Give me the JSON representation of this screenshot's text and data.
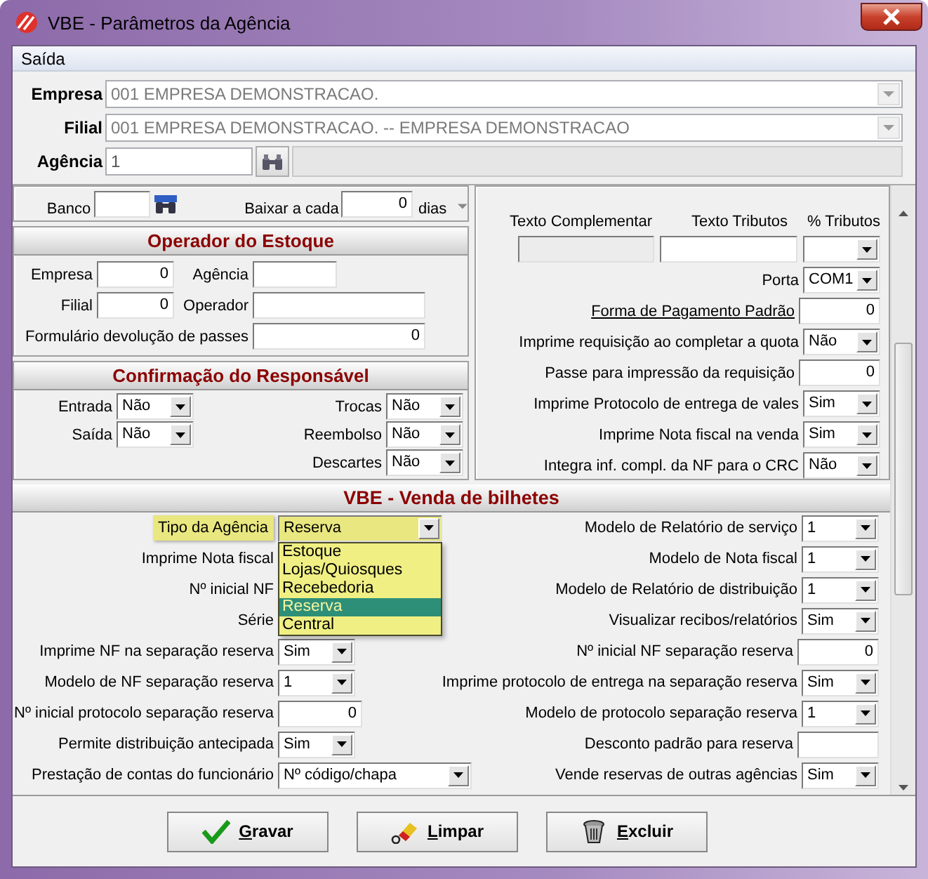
{
  "window": {
    "title": "VBE - Parâmetros da Agência"
  },
  "menu": [
    {
      "label": "Saída"
    }
  ],
  "header": [
    {
      "label": "Empresa",
      "value": "001 EMPRESA DEMONSTRACAO.",
      "kind": "select",
      "disabled": true
    },
    {
      "label": "Filial",
      "value": "001 EMPRESA DEMONSTRACAO. -- EMPRESA DEMONSTRACAO",
      "kind": "select",
      "disabled": true
    },
    {
      "label": "Agência",
      "value": "1",
      "kind": "lookup",
      "disabled": true
    }
  ],
  "banco": {
    "label": "Banco"
  },
  "baixar": {
    "label": "Baixar a cada",
    "value": "0",
    "unit": "dias"
  },
  "operador_estoque": {
    "title": "Operador do Estoque",
    "rows": [
      [
        {
          "label": "Empresa",
          "value": "0"
        },
        {
          "label": "Agência"
        }
      ],
      [
        {
          "label": "Filial",
          "value": "0"
        },
        {
          "label": "Operador"
        }
      ],
      [
        {
          "label": "Formulário devolução de passes",
          "value": "0"
        }
      ]
    ]
  },
  "confirmacao": {
    "title": "Confirmação do Responsável",
    "left": [
      {
        "label": "Entrada",
        "value": "Não"
      },
      {
        "label": "Saída",
        "value": "Não"
      }
    ],
    "right": [
      {
        "label": "Trocas",
        "value": "Não"
      },
      {
        "label": "Reembolso",
        "value": "Não"
      },
      {
        "label": "Descartes",
        "value": "Não"
      }
    ]
  },
  "tributos": {
    "columns": [
      "Texto Complementar",
      "Texto Tributos",
      "% Tributos"
    ],
    "fields": [
      {
        "kind": "input",
        "disabled": true
      },
      {
        "kind": "input",
        "disabled": false
      },
      {
        "kind": "select"
      }
    ]
  },
  "parametros": [
    {
      "label": "Porta",
      "kind": "select",
      "value": "COM1",
      "link": false
    },
    {
      "label": "Forma de Pagamento Padrão",
      "kind": "input",
      "value": "0",
      "link": true
    },
    {
      "label": "Imprime requisição ao completar a quota",
      "kind": "select",
      "value": "Não",
      "link": false
    },
    {
      "label": "Passe para impressão da requisição",
      "kind": "input",
      "value": "0",
      "link": false
    },
    {
      "label": "Imprime Protocolo de entrega de vales",
      "kind": "select",
      "value": "Sim",
      "link": false
    },
    {
      "label": "Imprime Nota fiscal na venda",
      "kind": "select",
      "value": "Sim",
      "link": false
    },
    {
      "label": "Integra inf. compl. da NF para o CRC",
      "kind": "select",
      "value": "Não",
      "link": false
    }
  ],
  "venda": {
    "title": "VBE - Venda de bilhetes",
    "left": [
      {
        "label": "Tipo da Agência",
        "kind": "medium-select",
        "value": "Reserva",
        "expanded": true,
        "options": [
          {
            "label": "Estoque",
            "selected": false
          },
          {
            "label": "Lojas/Quiosques",
            "selected": false
          },
          {
            "label": "Recebedoria",
            "selected": false
          },
          {
            "label": "Reserva",
            "selected": true
          },
          {
            "label": "Central",
            "selected": false
          }
        ]
      },
      {
        "label": "Imprime Nota fiscal",
        "kind": "none"
      },
      {
        "label": "Nº inicial NF",
        "kind": "none"
      },
      {
        "label": "Série",
        "kind": "none"
      },
      {
        "label": "Imprime NF na separação reserva",
        "kind": "select",
        "value": "Sim"
      },
      {
        "label": "Modelo de NF separação reserva",
        "kind": "select",
        "value": "1"
      },
      {
        "label": "Nº inicial protocolo separação reserva",
        "kind": "input",
        "value": "0"
      },
      {
        "label": "Permite distribuição antecipada",
        "kind": "select",
        "value": "Sim"
      },
      {
        "label": "Prestação de contas do funcionário",
        "kind": "wide-select",
        "value": "Nº código/chapa"
      }
    ],
    "right": [
      {
        "label": "Modelo de Relatório de serviço",
        "kind": "select",
        "value": "1"
      },
      {
        "label": "Modelo de Nota fiscal",
        "kind": "select",
        "value": "1"
      },
      {
        "label": "Modelo de Relatório de distribuição",
        "kind": "select",
        "value": "1"
      },
      {
        "label": "Visualizar recibos/relatórios",
        "kind": "select",
        "value": "Sim"
      },
      {
        "label": "Nº inicial NF separação reserva",
        "kind": "input",
        "value": "0"
      },
      {
        "label": "Imprime protocolo de entrega na separação reserva",
        "kind": "select",
        "value": "Sim"
      },
      {
        "label": "Modelo de protocolo separação reserva",
        "kind": "select",
        "value": "1"
      },
      {
        "label": "Desconto padrão para reserva",
        "kind": "input"
      },
      {
        "label": "Vende reservas de outras agências",
        "kind": "select",
        "value": "Sim"
      }
    ]
  },
  "buttons": [
    {
      "label": "Gravar",
      "kind": "check"
    },
    {
      "label": "Limpar",
      "kind": "eraser"
    },
    {
      "label": "Excluir",
      "kind": "trash"
    }
  ]
}
